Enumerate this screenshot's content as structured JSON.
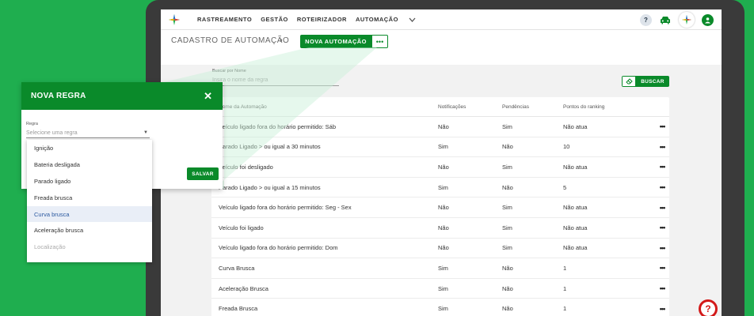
{
  "nav": {
    "items": [
      "RASTREAMENTO",
      "GESTÃO",
      "ROTEIRIZADOR",
      "AUTOMAÇÃO"
    ],
    "help": "?"
  },
  "page": {
    "title": "CADASTRO DE AUTOMAÇÃO",
    "arrow": "›",
    "new_button": "NOVA AUTOMAÇÃO",
    "more_button": "•••"
  },
  "search": {
    "label": "Buscar por Nome",
    "placeholder": "Insira o nome da regra",
    "button": "BUSCAR"
  },
  "table": {
    "headers": [
      "Nome da Automação",
      "Notificações",
      "Pendências",
      "Pontos do ranking"
    ],
    "rows": [
      [
        "Veículo ligado fora do horário permitido: Sáb",
        "Não",
        "Sim",
        "Não atua"
      ],
      [
        "Parado Ligado > ou igual a 30 minutos",
        "Sim",
        "Não",
        "10"
      ],
      [
        "Veículo foi desligado",
        "Não",
        "Sim",
        "Não atua"
      ],
      [
        "Parado Ligado > ou igual a 15 minutos",
        "Sim",
        "Não",
        "5"
      ],
      [
        "Veículo ligado fora do horário permitido: Seg - Sex",
        "Não",
        "Sim",
        "Não atua"
      ],
      [
        "Veículo foi ligado",
        "Não",
        "Sim",
        "Não atua"
      ],
      [
        "Veículo ligado fora do horário permitido: Dom",
        "Não",
        "Sim",
        "Não atua"
      ],
      [
        "Curva Brusca",
        "Sim",
        "Não",
        "1"
      ],
      [
        "Aceleração Brusca",
        "Sim",
        "Não",
        "1"
      ],
      [
        "Freada Brusca",
        "Sim",
        "Não",
        "1"
      ]
    ],
    "row_action": "•••"
  },
  "modal": {
    "title": "NOVA REGRA",
    "close": "✕",
    "rule_label": "Regra",
    "rule_placeholder": "Selecione uma regra",
    "save_button": "SALVAR"
  },
  "dropdown": {
    "options": [
      "Ignição",
      "Bateria desligada",
      "Parado ligado",
      "Freada brusca",
      "Curva brusca",
      "Aceleração brusca",
      "Localização"
    ],
    "highlighted_index": 4,
    "disabled_index": 6
  },
  "float_help": "?",
  "colors": {
    "background": "#1fae4f",
    "primary": "#0a8a2a",
    "help_red": "#d31919"
  }
}
